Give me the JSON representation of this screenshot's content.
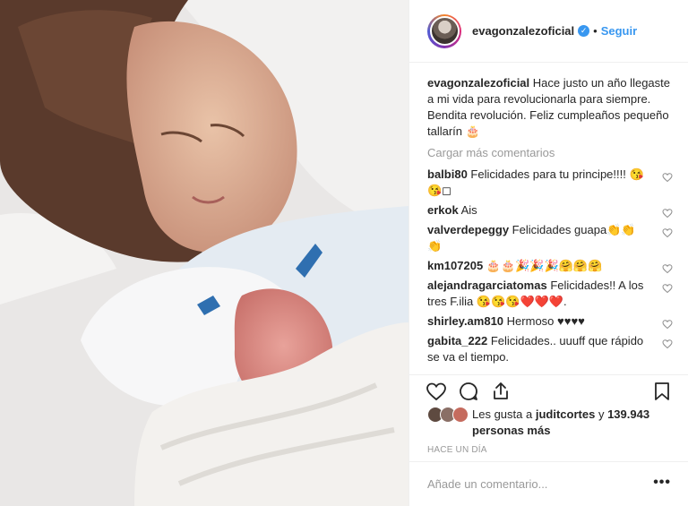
{
  "photo": {
    "alt": ""
  },
  "header": {
    "username": "evagonzalezoficial",
    "verified_icon": "verified-badge-icon",
    "separator": "•",
    "follow_label": "Seguir"
  },
  "caption": {
    "username": "evagonzalezoficial",
    "text": "Hace justo un año llegaste a mi vida para revolucionarla para siempre. Bendita revolución. Feliz cumpleaños pequeño tallarín 🎂"
  },
  "load_more": "Cargar más comentarios",
  "comments": [
    {
      "username": "balbi80",
      "text": "Felicidades para tu principe!!!! 😘😘◻"
    },
    {
      "username": "erkok",
      "text": "Ais"
    },
    {
      "username": "valverdepeggy",
      "text": "Felicidades guapa👏👏👏"
    },
    {
      "username": "km107205",
      "text": "🎂🎂🎉🎉🎉🤗🤗🤗"
    },
    {
      "username": "alejandragarciatomas",
      "text": "Felicidades!! A los tres F.ilia 😘😘😘❤️❤️❤️."
    },
    {
      "username": "shirley.am810",
      "text": "Hermoso ♥♥♥♥"
    },
    {
      "username": "gabita_222",
      "text": "Felicidades.. uuuff que rápido se va el tiempo."
    }
  ],
  "likes": {
    "prefix": "Les gusta a",
    "user": "juditcortes",
    "suffix": "y",
    "count": "139.943 personas más"
  },
  "time": "HACE UN DÍA",
  "add_comment": {
    "placeholder": "Añade un comentario...",
    "more": "•••"
  },
  "colors": {
    "link": "#3897f0",
    "muted": "#999999",
    "border": "#efefef"
  }
}
